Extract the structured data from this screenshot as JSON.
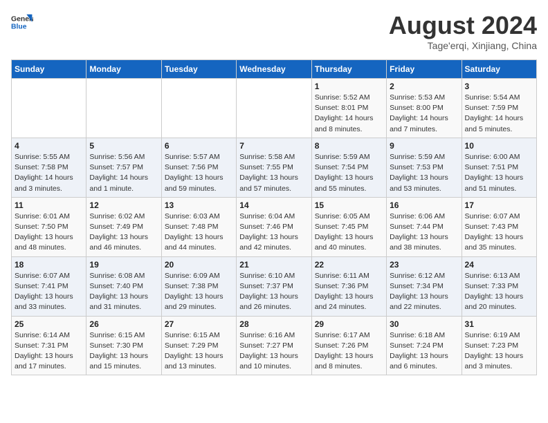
{
  "logo": {
    "line1": "General",
    "line2": "Blue"
  },
  "title": "August 2024",
  "location": "Tage'erqi, Xinjiang, China",
  "days_of_week": [
    "Sunday",
    "Monday",
    "Tuesday",
    "Wednesday",
    "Thursday",
    "Friday",
    "Saturday"
  ],
  "weeks": [
    [
      {
        "day": "",
        "info": ""
      },
      {
        "day": "",
        "info": ""
      },
      {
        "day": "",
        "info": ""
      },
      {
        "day": "",
        "info": ""
      },
      {
        "day": "1",
        "info": "Sunrise: 5:52 AM\nSunset: 8:01 PM\nDaylight: 14 hours\nand 8 minutes."
      },
      {
        "day": "2",
        "info": "Sunrise: 5:53 AM\nSunset: 8:00 PM\nDaylight: 14 hours\nand 7 minutes."
      },
      {
        "day": "3",
        "info": "Sunrise: 5:54 AM\nSunset: 7:59 PM\nDaylight: 14 hours\nand 5 minutes."
      }
    ],
    [
      {
        "day": "4",
        "info": "Sunrise: 5:55 AM\nSunset: 7:58 PM\nDaylight: 14 hours\nand 3 minutes."
      },
      {
        "day": "5",
        "info": "Sunrise: 5:56 AM\nSunset: 7:57 PM\nDaylight: 14 hours\nand 1 minute."
      },
      {
        "day": "6",
        "info": "Sunrise: 5:57 AM\nSunset: 7:56 PM\nDaylight: 13 hours\nand 59 minutes."
      },
      {
        "day": "7",
        "info": "Sunrise: 5:58 AM\nSunset: 7:55 PM\nDaylight: 13 hours\nand 57 minutes."
      },
      {
        "day": "8",
        "info": "Sunrise: 5:59 AM\nSunset: 7:54 PM\nDaylight: 13 hours\nand 55 minutes."
      },
      {
        "day": "9",
        "info": "Sunrise: 5:59 AM\nSunset: 7:53 PM\nDaylight: 13 hours\nand 53 minutes."
      },
      {
        "day": "10",
        "info": "Sunrise: 6:00 AM\nSunset: 7:51 PM\nDaylight: 13 hours\nand 51 minutes."
      }
    ],
    [
      {
        "day": "11",
        "info": "Sunrise: 6:01 AM\nSunset: 7:50 PM\nDaylight: 13 hours\nand 48 minutes."
      },
      {
        "day": "12",
        "info": "Sunrise: 6:02 AM\nSunset: 7:49 PM\nDaylight: 13 hours\nand 46 minutes."
      },
      {
        "day": "13",
        "info": "Sunrise: 6:03 AM\nSunset: 7:48 PM\nDaylight: 13 hours\nand 44 minutes."
      },
      {
        "day": "14",
        "info": "Sunrise: 6:04 AM\nSunset: 7:46 PM\nDaylight: 13 hours\nand 42 minutes."
      },
      {
        "day": "15",
        "info": "Sunrise: 6:05 AM\nSunset: 7:45 PM\nDaylight: 13 hours\nand 40 minutes."
      },
      {
        "day": "16",
        "info": "Sunrise: 6:06 AM\nSunset: 7:44 PM\nDaylight: 13 hours\nand 38 minutes."
      },
      {
        "day": "17",
        "info": "Sunrise: 6:07 AM\nSunset: 7:43 PM\nDaylight: 13 hours\nand 35 minutes."
      }
    ],
    [
      {
        "day": "18",
        "info": "Sunrise: 6:07 AM\nSunset: 7:41 PM\nDaylight: 13 hours\nand 33 minutes."
      },
      {
        "day": "19",
        "info": "Sunrise: 6:08 AM\nSunset: 7:40 PM\nDaylight: 13 hours\nand 31 minutes."
      },
      {
        "day": "20",
        "info": "Sunrise: 6:09 AM\nSunset: 7:38 PM\nDaylight: 13 hours\nand 29 minutes."
      },
      {
        "day": "21",
        "info": "Sunrise: 6:10 AM\nSunset: 7:37 PM\nDaylight: 13 hours\nand 26 minutes."
      },
      {
        "day": "22",
        "info": "Sunrise: 6:11 AM\nSunset: 7:36 PM\nDaylight: 13 hours\nand 24 minutes."
      },
      {
        "day": "23",
        "info": "Sunrise: 6:12 AM\nSunset: 7:34 PM\nDaylight: 13 hours\nand 22 minutes."
      },
      {
        "day": "24",
        "info": "Sunrise: 6:13 AM\nSunset: 7:33 PM\nDaylight: 13 hours\nand 20 minutes."
      }
    ],
    [
      {
        "day": "25",
        "info": "Sunrise: 6:14 AM\nSunset: 7:31 PM\nDaylight: 13 hours\nand 17 minutes."
      },
      {
        "day": "26",
        "info": "Sunrise: 6:15 AM\nSunset: 7:30 PM\nDaylight: 13 hours\nand 15 minutes."
      },
      {
        "day": "27",
        "info": "Sunrise: 6:15 AM\nSunset: 7:29 PM\nDaylight: 13 hours\nand 13 minutes."
      },
      {
        "day": "28",
        "info": "Sunrise: 6:16 AM\nSunset: 7:27 PM\nDaylight: 13 hours\nand 10 minutes."
      },
      {
        "day": "29",
        "info": "Sunrise: 6:17 AM\nSunset: 7:26 PM\nDaylight: 13 hours\nand 8 minutes."
      },
      {
        "day": "30",
        "info": "Sunrise: 6:18 AM\nSunset: 7:24 PM\nDaylight: 13 hours\nand 6 minutes."
      },
      {
        "day": "31",
        "info": "Sunrise: 6:19 AM\nSunset: 7:23 PM\nDaylight: 13 hours\nand 3 minutes."
      }
    ]
  ]
}
